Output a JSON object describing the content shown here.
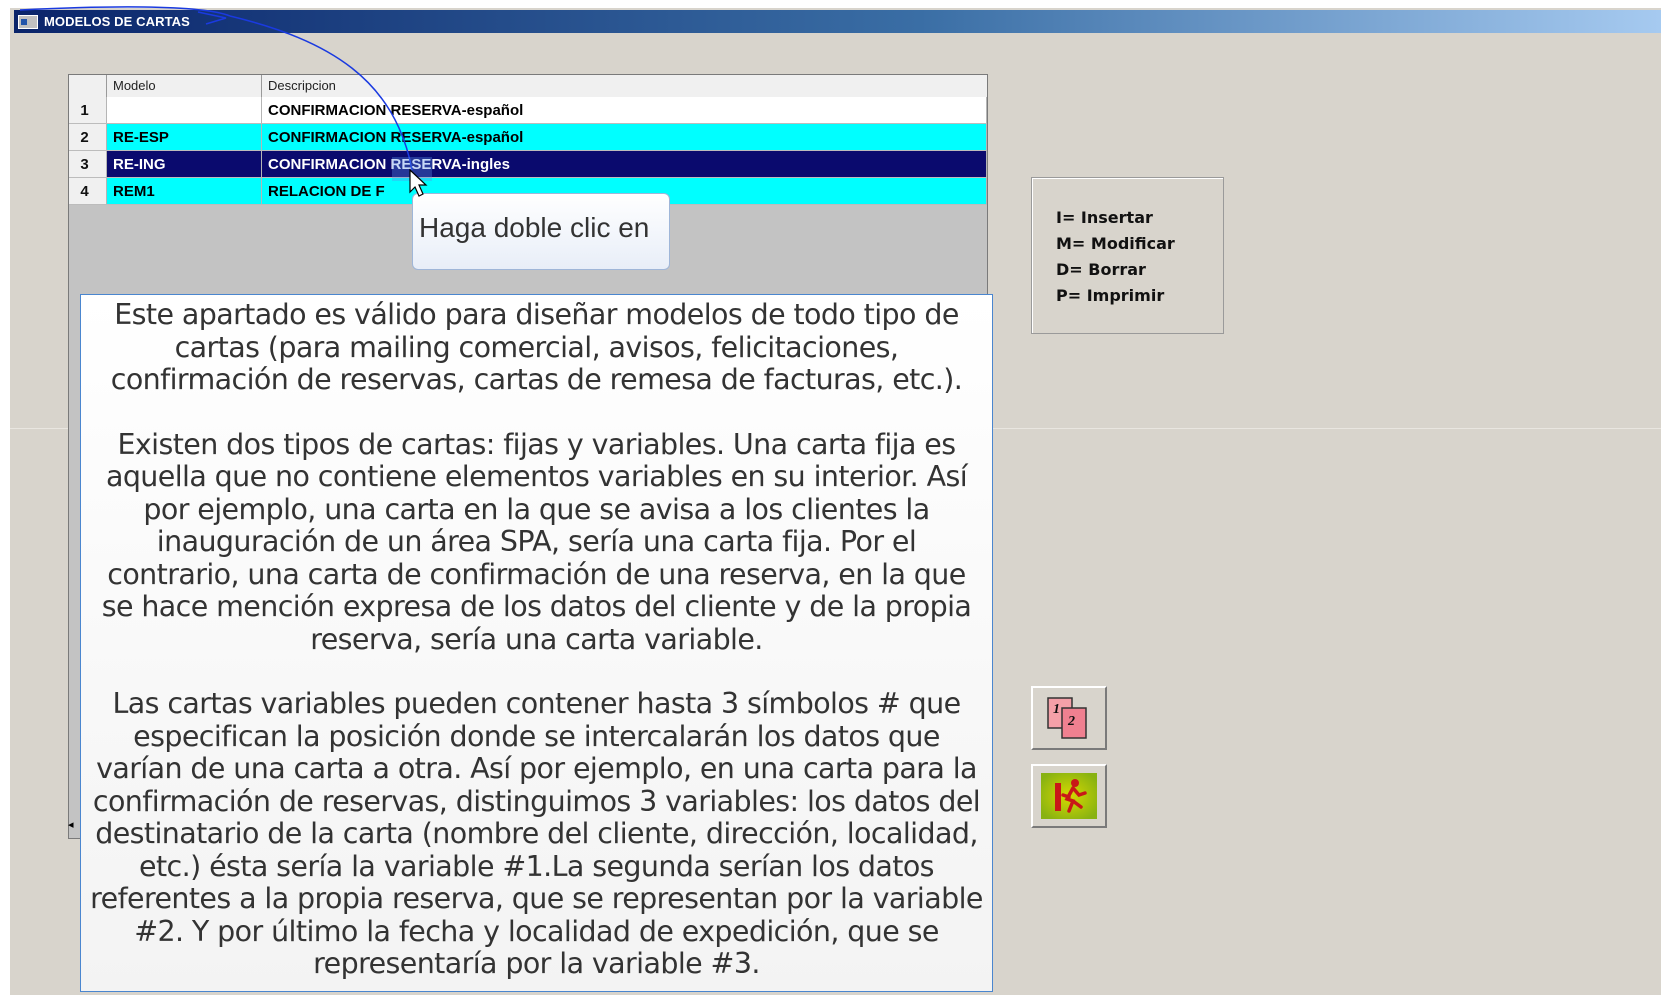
{
  "window": {
    "title": "MODELOS DE CARTAS"
  },
  "grid": {
    "columns": [
      "Modelo",
      "Descripcion"
    ],
    "rows": [
      {
        "num": "1",
        "modelo": "",
        "descripcion": "CONFIRMACION RESERVA-español",
        "style": "white"
      },
      {
        "num": "2",
        "modelo": "RE-ESP",
        "descripcion": "CONFIRMACION RESERVA-español",
        "style": "cyan"
      },
      {
        "num": "3",
        "modelo": "RE-ING",
        "descripcion": "CONFIRMACION RESERVA-ingles",
        "style": "selected"
      },
      {
        "num": "4",
        "modelo": "REM1",
        "descripcion": "RELACION DE F",
        "style": "cyan"
      }
    ]
  },
  "tooltip": {
    "text": "Haga doble clic en"
  },
  "info": {
    "paragraphs": [
      "Este apartado es válido para diseñar modelos de todo tipo de cartas (para mailing comercial, avisos, felicitaciones, confirmación de reservas, cartas de remesa de facturas, etc.).",
      "Existen dos tipos de cartas: fijas y variables. Una carta fija es aquella que no contiene elementos variables en su interior. Así por ejemplo, una carta en la que se avisa a los clientes la inauguración de un área SPA, sería una carta fija. Por el contrario, una carta de confirmación de una reserva, en la que se hace mención expresa de los datos del cliente y de la propia reserva, sería una carta variable.",
      "Las cartas variables pueden contener hasta 3 símbolos # que especifican la posición donde se intercalarán los datos que varían de una carta a otra. Así por ejemplo, en una carta para la confirmación de reservas, distinguimos 3 variables: los datos del destinatario de la carta (nombre del cliente, dirección, localidad, etc.) ésta sería la variable #1.La segunda serían los datos referentes a la propia reserva, que se representan por la variable #2. Y por último la fecha y localidad de expedición, que se representaría por la variable #3."
    ]
  },
  "legend": {
    "items": [
      "I= Insertar",
      "M= Modificar",
      "D= Borrar",
      "P= Imprimir"
    ]
  },
  "buttons": {
    "pages_icon": "pages-1-2-icon",
    "exit_icon": "exit-door-running-icon",
    "pages_label_1": "1",
    "pages_label_2": "2"
  },
  "colors": {
    "selected_row": "#0a0a6e",
    "highlight_row": "#00ffff",
    "titlebar": "#0a246a"
  }
}
